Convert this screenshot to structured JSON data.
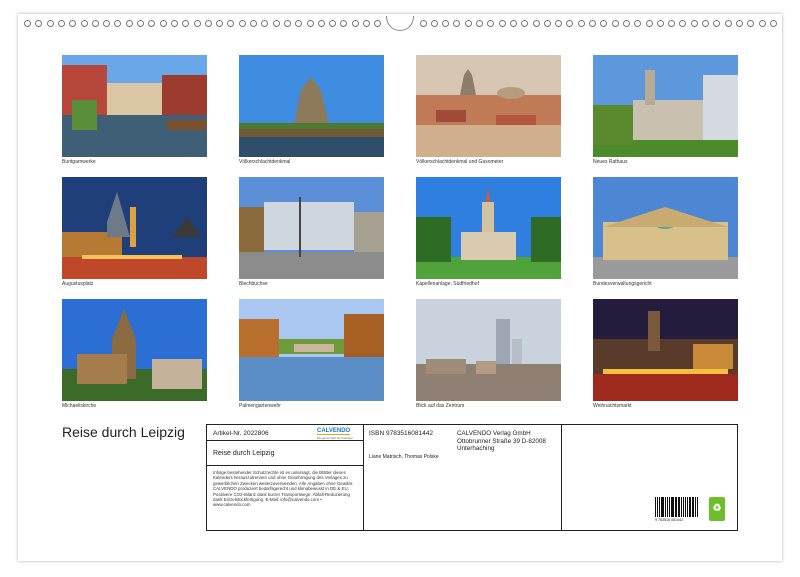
{
  "calendar_title": "Reise durch Leipzig",
  "photos": [
    {
      "caption": "Buntgarnwerke",
      "scene": "canal"
    },
    {
      "caption": "Völkerschlachtdenkmal",
      "scene": "monument"
    },
    {
      "caption": "Völkerschlachtdenkmal und Gasometer",
      "scene": "cityscape"
    },
    {
      "caption": "Neues Rathaus",
      "scene": "cityhall"
    },
    {
      "caption": "Augustusplatz",
      "scene": "nightsquare"
    },
    {
      "caption": "Blechbüchse",
      "scene": "modern"
    },
    {
      "caption": "Kapellenanlage, Südfriedhof",
      "scene": "chapel"
    },
    {
      "caption": "Bundesverwaltungsgericht",
      "scene": "court"
    },
    {
      "caption": "Michaeliskirche",
      "scene": "church"
    },
    {
      "caption": "Palmengartenwehr",
      "scene": "lake"
    },
    {
      "caption": "Blick auf das Zentrum",
      "scene": "skyline"
    },
    {
      "caption": "Weihnachtsmarkt",
      "scene": "xmas"
    }
  ],
  "info": {
    "article": "Artikel-Nr. 2022806",
    "logo": "CALVENDO",
    "logo_sub": "Die ganze Welt der Kalender",
    "title": "Reise durch Leipzig",
    "legal": "Infolge bestehender Schutzrechte ist es untersagt, die Blätter dieses Kalenders herauszutrennen und ohne Genehmigung des Verlages zu gewerblichen Zwecken weiterzuverwenden. Alle Angaben ohne Gewähr. CALVENDO produziert bedarfsgerecht und klimabewusst in DE & EU. Positivere CO2-Bilanz dank kurzer Transportwege. Abfall-Reduzierung dank Einzelstückfertigung. E-Mail: info@calvendo.com • www.calvendo.com",
    "isbn": "ISBN 9783516081442",
    "authors": "Liane Matrisch, Thomas Polske",
    "publisher": "CALVENDO Verlag GmbH Ottobrunner Straße 39 D-82008 Unterhaching",
    "barcode_number": "9 783516 081442",
    "eco_badge": "♻"
  }
}
